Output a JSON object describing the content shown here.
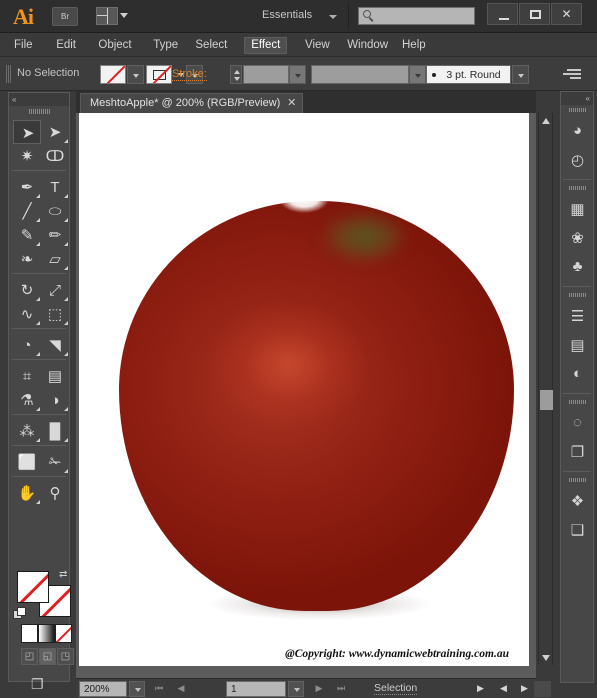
{
  "app": {
    "logo": "Ai",
    "bridge_button": "Br",
    "workspace": "Essentials",
    "search_placeholder": ""
  },
  "window_controls": {
    "minimize": "–",
    "maximize": "□",
    "close": "✕"
  },
  "menubar": {
    "items": [
      {
        "label": "File",
        "active": false
      },
      {
        "label": "Edit",
        "active": false
      },
      {
        "label": "Object",
        "active": false
      },
      {
        "label": "Type",
        "active": false
      },
      {
        "label": "Select",
        "active": false
      },
      {
        "label": "Effect",
        "active": true
      },
      {
        "label": "View",
        "active": false
      },
      {
        "label": "Window",
        "active": false
      },
      {
        "label": "Help",
        "active": false
      }
    ]
  },
  "control_bar": {
    "selection_status": "No Selection",
    "fill_label": "Fill",
    "stroke_swatch_label": "Stroke swatch",
    "stroke_label": "Stroke:",
    "stroke_weight": "",
    "variable_width": "",
    "brush_definition": "3 pt. Round",
    "options_menu": "Options"
  },
  "document": {
    "tab_title": "MeshtoApple* @ 200% (RGB/Preview)",
    "tab_close": "✕",
    "artwork_caption": "@Copyright: www.dynamicwebtraining.com.au"
  },
  "artwork": {
    "name": "mesh-gradient-apple",
    "body_color": "#8f1f12",
    "highlight_color": "#c6482d",
    "shadow_color": "#6d1105",
    "stem_patch_color": "#4a6424"
  },
  "toolbar": {
    "collapse": "«",
    "tools": [
      {
        "name": "selection-tool",
        "glyph": "➤",
        "selected": true,
        "flyout": false
      },
      {
        "name": "direct-selection-tool",
        "glyph": "➤",
        "selected": false,
        "flyout": true
      },
      {
        "name": "magic-wand-tool",
        "glyph": "✷",
        "selected": false,
        "flyout": false
      },
      {
        "name": "lasso-tool",
        "glyph": "ↀ",
        "selected": false,
        "flyout": false
      },
      {
        "name": "pen-tool",
        "glyph": "✒",
        "selected": false,
        "flyout": true
      },
      {
        "name": "type-tool",
        "glyph": "T",
        "selected": false,
        "flyout": true
      },
      {
        "name": "line-segment-tool",
        "glyph": "╱",
        "selected": false,
        "flyout": true
      },
      {
        "name": "ellipse-shape-tool",
        "glyph": "⬭",
        "selected": false,
        "flyout": true
      },
      {
        "name": "paintbrush-tool",
        "glyph": "✎",
        "selected": false,
        "flyout": true
      },
      {
        "name": "pencil-tool",
        "glyph": "✏",
        "selected": false,
        "flyout": true
      },
      {
        "name": "blob-brush-tool",
        "glyph": "❧",
        "selected": false,
        "flyout": false
      },
      {
        "name": "eraser-tool",
        "glyph": "▱",
        "selected": false,
        "flyout": true
      },
      {
        "name": "rotate-tool",
        "glyph": "↻",
        "selected": false,
        "flyout": true
      },
      {
        "name": "scale-tool",
        "glyph": "⤢",
        "selected": false,
        "flyout": true
      },
      {
        "name": "width-warp-tool",
        "glyph": "∿",
        "selected": false,
        "flyout": true
      },
      {
        "name": "free-transform-tool",
        "glyph": "⬚",
        "selected": false,
        "flyout": true
      },
      {
        "name": "shape-builder-tool",
        "glyph": "◔",
        "selected": false,
        "flyout": true
      },
      {
        "name": "perspective-grid-tool",
        "glyph": "◥",
        "selected": false,
        "flyout": true
      },
      {
        "name": "mesh-tool",
        "glyph": "⌗",
        "selected": false,
        "flyout": false
      },
      {
        "name": "gradient-tool",
        "glyph": "▤",
        "selected": false,
        "flyout": false
      },
      {
        "name": "eyedropper-tool",
        "glyph": "⚗",
        "selected": false,
        "flyout": true
      },
      {
        "name": "blend-tool",
        "glyph": "◑",
        "selected": false,
        "flyout": true
      },
      {
        "name": "symbol-sprayer-tool",
        "glyph": "⁂",
        "selected": false,
        "flyout": true
      },
      {
        "name": "column-graph-tool",
        "glyph": "█",
        "selected": false,
        "flyout": true
      },
      {
        "name": "artboard-tool",
        "glyph": "⬜",
        "selected": false,
        "flyout": false
      },
      {
        "name": "slice-tool",
        "glyph": "✁",
        "selected": false,
        "flyout": true
      },
      {
        "name": "hand-tool",
        "glyph": "✋",
        "selected": false,
        "flyout": true
      },
      {
        "name": "zoom-tool",
        "glyph": "⚲",
        "selected": false,
        "flyout": false
      }
    ],
    "fill_stroke": {
      "fill_name": "fill-swatch",
      "stroke_name": "stroke-swatch",
      "swap_glyph": "⇄",
      "fill_value": "None",
      "stroke_value": "None"
    },
    "color_modes": [
      {
        "name": "color-mode-button",
        "label": "Color"
      },
      {
        "name": "gradient-mode-button",
        "label": "Gradient"
      },
      {
        "name": "none-mode-button",
        "label": "None"
      }
    ],
    "draw_modes": [
      {
        "name": "draw-normal-button",
        "glyph": "◰",
        "active": false
      },
      {
        "name": "draw-behind-button",
        "glyph": "◱",
        "active": true
      },
      {
        "name": "draw-inside-button",
        "glyph": "◳",
        "active": false
      }
    ],
    "screen_mode": {
      "name": "change-screen-mode-button",
      "glyph": "❐"
    }
  },
  "right_panels": {
    "collapse": "«",
    "groups": [
      {
        "items": [
          {
            "name": "color-panel-icon",
            "glyph": "◕",
            "label": "Color"
          },
          {
            "name": "color-guide-icon",
            "glyph": "◴",
            "label": "Color Guide"
          }
        ]
      },
      {
        "items": [
          {
            "name": "swatches-panel-icon",
            "glyph": "▦",
            "label": "Swatches"
          },
          {
            "name": "brushes-panel-icon",
            "glyph": "❀",
            "label": "Brushes"
          },
          {
            "name": "symbols-panel-icon",
            "glyph": "♣",
            "label": "Symbols"
          }
        ]
      },
      {
        "items": [
          {
            "name": "stroke-panel-icon",
            "glyph": "☰",
            "label": "Stroke"
          },
          {
            "name": "gradient-panel-icon",
            "glyph": "▤",
            "label": "Gradient"
          },
          {
            "name": "transparency-panel-icon",
            "glyph": "◐",
            "label": "Transparency"
          }
        ]
      },
      {
        "items": [
          {
            "name": "appearance-panel-icon",
            "glyph": "◌",
            "label": "Appearance"
          },
          {
            "name": "graphic-styles-panel-icon",
            "glyph": "❐",
            "label": "Graphic Styles"
          }
        ]
      },
      {
        "items": [
          {
            "name": "layers-panel-icon",
            "glyph": "❖",
            "label": "Layers"
          },
          {
            "name": "artboards-panel-icon",
            "glyph": "❑",
            "label": "Artboards"
          }
        ]
      }
    ]
  },
  "status_bar": {
    "zoom_level": "200%",
    "page_number": "1",
    "status_text": "Selection",
    "first_page": "⏮",
    "prev_page": "◀",
    "next_page": "▶",
    "last_page": "⏭",
    "status_menu": "▶",
    "nav_prev": "◀",
    "nav_next": "▶"
  },
  "theme": {
    "panel_bg": "#474747",
    "chrome_bg": "#3a3a3a",
    "accent_orange": "#e08020",
    "canvas_bg": "#5c5c5c"
  }
}
